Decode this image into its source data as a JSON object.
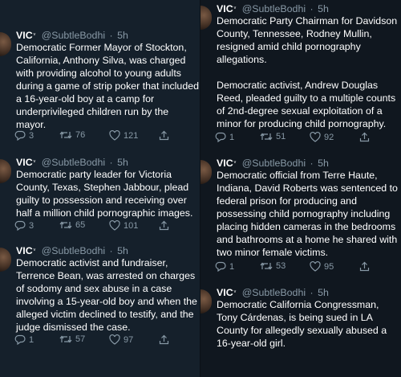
{
  "author": {
    "name": "VIC",
    "verified_mark": "ᵛ",
    "handle": "@SubtleBodhi",
    "sep": "·"
  },
  "icons": {
    "reply": "reply-icon",
    "retweet": "retweet-icon",
    "like": "heart-icon",
    "share": "share-icon"
  },
  "colors": {
    "background": "#15202b",
    "muted": "#8899a6",
    "text": "#ffffff"
  },
  "tweets": [
    {
      "time": "5h",
      "text": "Democratic Former Mayor of Stockton, California, Anthony Silva, was charged with providing alcohol to young adults during a game of strip poker that included a 16-year-old boy at a camp for underprivileged children run by the mayor.",
      "replies": "3",
      "retweets": "76",
      "likes": "121"
    },
    {
      "time": "5h",
      "text": "Democratic party leader for Victoria County, Texas, Stephen Jabbour, plead guilty to possession and receiving over half a million child pornographic images.",
      "replies": "3",
      "retweets": "65",
      "likes": "101"
    },
    {
      "time": "5h",
      "text": "Democratic activist and fundraiser, Terrence Bean, was arrested on charges of sodomy and sex abuse in a case involving a 15-year-old boy and when the alleged victim declined to testify, and the judge dismissed the case.",
      "replies": "1",
      "retweets": "57",
      "likes": "97"
    },
    {
      "time": "5h",
      "text": "Democratic Party Chairman for Davidson County, Tennessee, Rodney Mullin, resigned amid child pornography allegations.",
      "text2": "Democratic activist, Andrew Douglas Reed, pleaded guilty to a multiple counts of 2nd-degree sexual exploitation of a minor for producing child pornography.",
      "replies": "1",
      "retweets": "51",
      "likes": "92"
    },
    {
      "time": "5h",
      "text": "Democratic official from Terre Haute, Indiana, David Roberts was sentenced to federal prison for producing and possessing child pornography including placing hidden cameras in the bedrooms and bathrooms at a home he shared with two minor female victims.",
      "replies": "1",
      "retweets": "53",
      "likes": "95"
    },
    {
      "time": "5h",
      "text": "Democratic California Congressman, Tony Cárdenas, is being sued in LA County for allegedly sexually abused a 16-year-old girl."
    }
  ]
}
